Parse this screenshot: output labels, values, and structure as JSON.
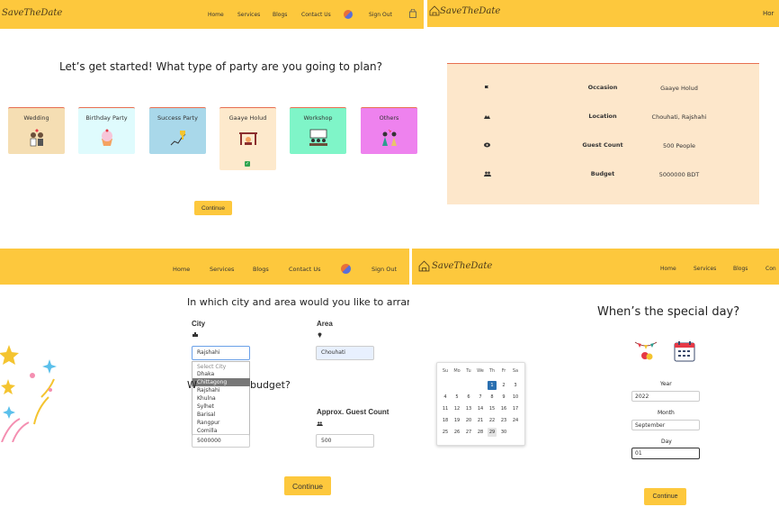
{
  "brand": {
    "logo_text": "SaveTheDate"
  },
  "panel1": {
    "nav": [
      "Home",
      "Services",
      "Blogs",
      "Contact Us",
      "Sign Out"
    ],
    "heading": "Let’s get started! What type of party are you going to plan?",
    "cards": [
      {
        "label": "Wedding",
        "color": "#f5deb3"
      },
      {
        "label": "Birthday Party",
        "color": "#dffbfd"
      },
      {
        "label": "Success Party",
        "color": "#a9d8ea"
      },
      {
        "label": "Gaaye Holud",
        "color": "#fde9cc"
      },
      {
        "label": "Workshop",
        "color": "#7ff5c8"
      },
      {
        "label": "Others",
        "color": "#ee82ee"
      }
    ],
    "continue": "Continue"
  },
  "panel2": {
    "nav_partial": "Hor",
    "rows": [
      {
        "key": "Occasion",
        "value": "Gaaye Holud",
        "icon": "flag-icon"
      },
      {
        "key": "Location",
        "value": "Chouhati, Rajshahi",
        "icon": "location-icon"
      },
      {
        "key": "Guest Count",
        "value": "500 People",
        "icon": "eye-icon"
      },
      {
        "key": "Budget",
        "value": "5000000 BDT",
        "icon": "people-icon"
      }
    ]
  },
  "panel3": {
    "nav": [
      "Home",
      "Services",
      "Blogs",
      "Contact Us",
      "Sign Out"
    ],
    "heading": "In which city and area would you like to arrang",
    "city_label": "City",
    "area_label": "Area",
    "city_value": "Rajshahi",
    "area_value": "Chouhati",
    "city_options": [
      "Select City",
      "Dhaka",
      "Chittagong",
      "Rajshahi",
      "Khulna",
      "Sylhet",
      "Barisal",
      "Rangpur",
      "Comilla"
    ],
    "budget_heading_start": "W",
    "budget_heading_end": "budget?",
    "guest_label": "Approx. Guest Count",
    "budget_value": "5000000",
    "guest_value": "500",
    "continue": "Continue"
  },
  "panel4": {
    "nav": [
      "Home",
      "Services",
      "Blogs",
      "Con"
    ],
    "heading": "When’s the special day?",
    "year_label": "Year",
    "year_value": "2022",
    "month_label": "Month",
    "month_value": "September",
    "day_label": "Day",
    "day_value": "01",
    "continue": "Continue",
    "calendar": {
      "weekdays": [
        "Su",
        "Mo",
        "Tu",
        "We",
        "Th",
        "Fr",
        "Sa"
      ],
      "weeks": [
        [
          "",
          "",
          "",
          "",
          "1",
          "2",
          "3"
        ],
        [
          "4",
          "5",
          "6",
          "7",
          "8",
          "9",
          "10"
        ],
        [
          "11",
          "12",
          "13",
          "14",
          "15",
          "16",
          "17"
        ],
        [
          "18",
          "19",
          "20",
          "21",
          "22",
          "23",
          "24"
        ],
        [
          "25",
          "26",
          "27",
          "28",
          "29",
          "30",
          ""
        ]
      ],
      "selected": "1",
      "highlighted": "29"
    }
  }
}
